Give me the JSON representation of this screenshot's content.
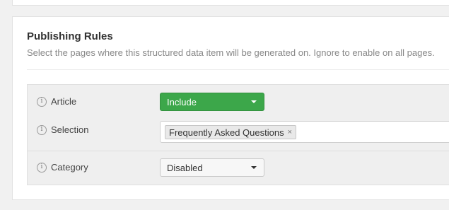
{
  "section": {
    "title": "Publishing Rules",
    "description": "Select the pages where this structured data item will be generated on. Ignore to enable on all pages."
  },
  "rules": [
    {
      "label": "Article",
      "control": "select",
      "value": "Include",
      "color": "#3ca74a"
    },
    {
      "label": "Selection",
      "control": "tags",
      "tags": [
        "Frequently Asked Questions"
      ],
      "remove_glyph": "×"
    },
    {
      "label": "Category",
      "control": "select",
      "value": "Disabled"
    }
  ],
  "icons": {
    "info": "info-icon",
    "caret": "chevron-down-icon",
    "remove": "close-icon"
  },
  "info_glyph": "i"
}
